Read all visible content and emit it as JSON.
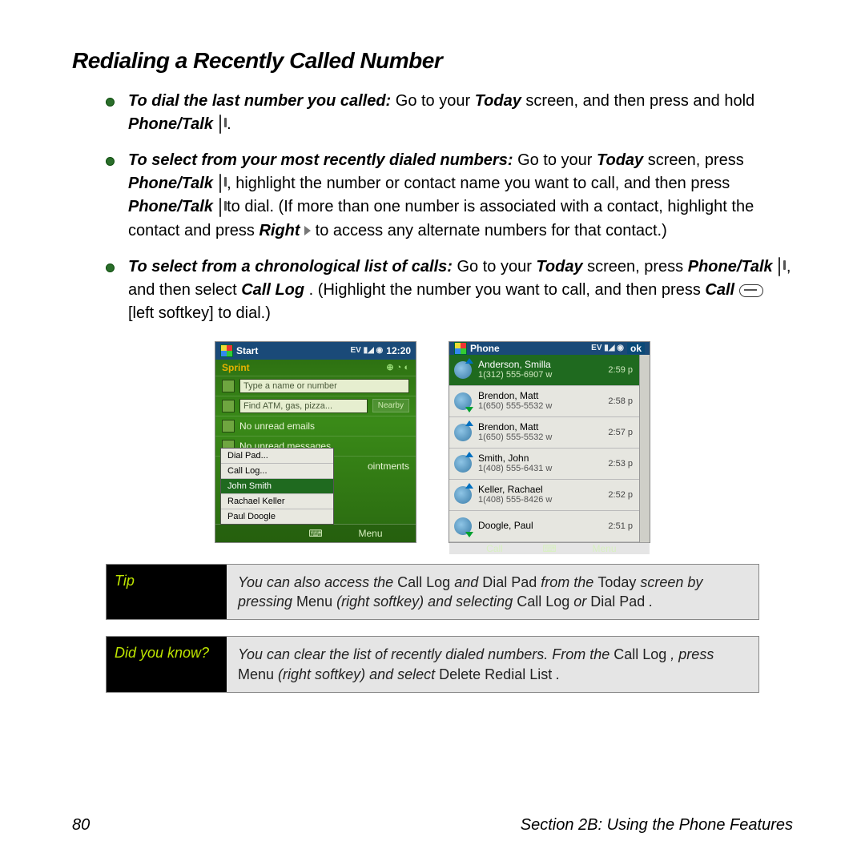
{
  "heading": "Redialing a Recently Called Number",
  "bullet1": {
    "lead": "To dial the last number you called:",
    "a": " Go to your ",
    "today": "Today",
    "b": " screen, and then press and hold ",
    "pt": "Phone/Talk",
    "end": " ."
  },
  "bullet2": {
    "lead": "To select from your most recently dialed numbers:",
    "a": " Go to your ",
    "today": "Today",
    "b": " screen, press ",
    "pt1": "Phone/Talk",
    "c": " , highlight the number or contact name you want to call, and then press ",
    "pt2": "Phone/Talk",
    "d": "  to dial. (If more than one number is associated with a contact, highlight the contact and press ",
    "right": "Right",
    "e": "  to access any alternate numbers for that contact.)"
  },
  "bullet3": {
    "lead": "To select from a chronological list of calls:",
    "a": " Go to your ",
    "today": "Today",
    "b": " screen, press ",
    "pt": "Phone/Talk",
    "c": " , and then select ",
    "calllog": "Call Log",
    "d": ". (Highlight the number you want to call, and then press ",
    "call": "Call",
    "e": "  [left softkey] to dial.)"
  },
  "screen_today": {
    "title": "Start",
    "clock": "12:20",
    "status_icons": "EV ▮◢ ◉",
    "carrier": "Sprint",
    "sub_icons": "⊕ ◔ ◐",
    "name_input": "Type a name or number",
    "find_input": "Find ATM, gas, pizza...",
    "nearby": "Nearby",
    "emails": "No unread emails",
    "messages": "No unread messages",
    "popup": [
      "Dial Pad...",
      "Call Log...",
      "John Smith",
      "Rachael Keller",
      "Paul Doogle"
    ],
    "row_label": "ointments",
    "sk_right": "Menu"
  },
  "screen_log": {
    "title": "Phone",
    "status_icons": "EV ▮◢ ◉",
    "ok": "ok",
    "entries": [
      {
        "name": "Anderson, Smilla",
        "num": "1(312) 555-6907 w",
        "time": "2:59 p",
        "dir": "in",
        "sel": true
      },
      {
        "name": "Brendon, Matt",
        "num": "1(650) 555-5532 w",
        "time": "2:58 p",
        "dir": "out",
        "sel": false
      },
      {
        "name": "Brendon, Matt",
        "num": "1(650) 555-5532 w",
        "time": "2:57 p",
        "dir": "in",
        "sel": false
      },
      {
        "name": "Smith, John",
        "num": "1(408) 555-6431 w",
        "time": "2:53 p",
        "dir": "in",
        "sel": false
      },
      {
        "name": "Keller, Rachael",
        "num": "1(408) 555-8426 w",
        "time": "2:52 p",
        "dir": "in",
        "sel": false
      },
      {
        "name": "Doogle, Paul",
        "num": "",
        "time": "2:51 p",
        "dir": "out",
        "sel": false
      }
    ],
    "sk_left": "Call",
    "sk_right": "Menu"
  },
  "tip": {
    "label": "Tip",
    "t1": "You can also access the ",
    "calllog": "Call Log",
    "t2": " and ",
    "dialpad": "Dial Pad",
    "t3": " from the ",
    "today": "Today",
    "t4": " screen by pressing ",
    "menu": "Menu",
    "t5": " (right softkey) and selecting ",
    "calllog2": "Call Log",
    "t6": " or ",
    "dialpad2": "Dial Pad",
    "t7": "."
  },
  "dyk": {
    "label": "Did you know?",
    "t1": "You can clear the list of recently dialed numbers. From the ",
    "calllog": "Call Log",
    "t2": ", press ",
    "menu": "Menu",
    "t3": " (right softkey) and select ",
    "del": "Delete Redial List",
    "t4": "."
  },
  "footer": {
    "page": "80",
    "section": "Section 2B: Using the Phone Features"
  }
}
